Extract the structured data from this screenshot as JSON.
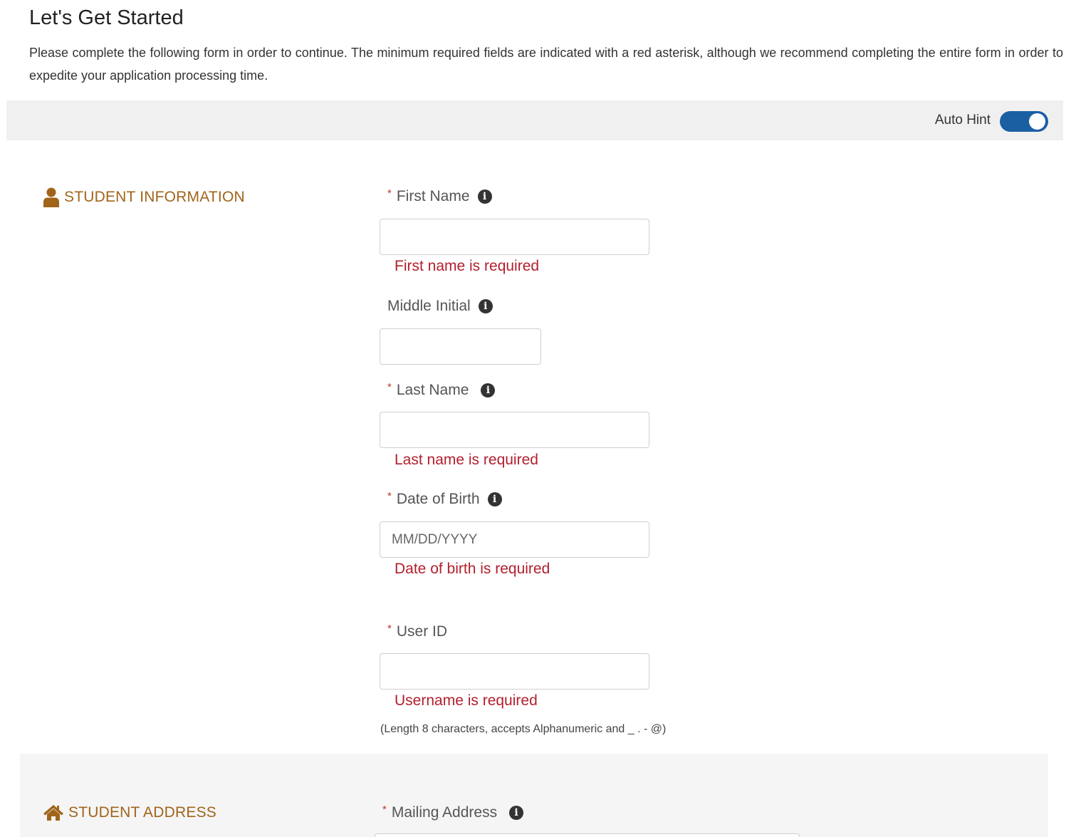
{
  "header": {
    "title": "Let's Get Started",
    "intro": "Please complete the following form in order to continue. The minimum required fields are indicated with a red asterisk, although we recommend completing the entire form in order to expedite your application processing time."
  },
  "hint_bar": {
    "label": "Auto Hint",
    "toggle_on": true
  },
  "colors": {
    "section_heading": "#a0641a",
    "error": "#b21f2d",
    "required_asterisk": "#c0392b",
    "toggle_on": "#1b5fa3",
    "hint_bar_bg": "#f0f0f0"
  },
  "student_information": {
    "heading": "STUDENT INFORMATION",
    "icon": "user-icon",
    "fields": {
      "first_name": {
        "label": "First Name",
        "required_mark": "*",
        "value": "",
        "error": "First name is required"
      },
      "middle_initial": {
        "label": "Middle Initial",
        "value": ""
      },
      "last_name": {
        "label": "Last Name",
        "required_mark": "*",
        "value": "",
        "error": "Last name is required"
      },
      "date_of_birth": {
        "label": "Date of Birth",
        "required_mark": "*",
        "value": "",
        "placeholder": "MM/DD/YYYY",
        "error": "Date of birth is required"
      },
      "user_id": {
        "label": "User ID",
        "required_mark": "*",
        "value": "",
        "error": "Username is required",
        "help": "(Length 8 characters, accepts Alphanumeric and _ . - @)"
      }
    }
  },
  "student_address": {
    "heading": "STUDENT ADDRESS",
    "icon": "home-icon",
    "fields": {
      "mailing_address": {
        "label": "Mailing Address",
        "required_mark": "*"
      }
    }
  }
}
